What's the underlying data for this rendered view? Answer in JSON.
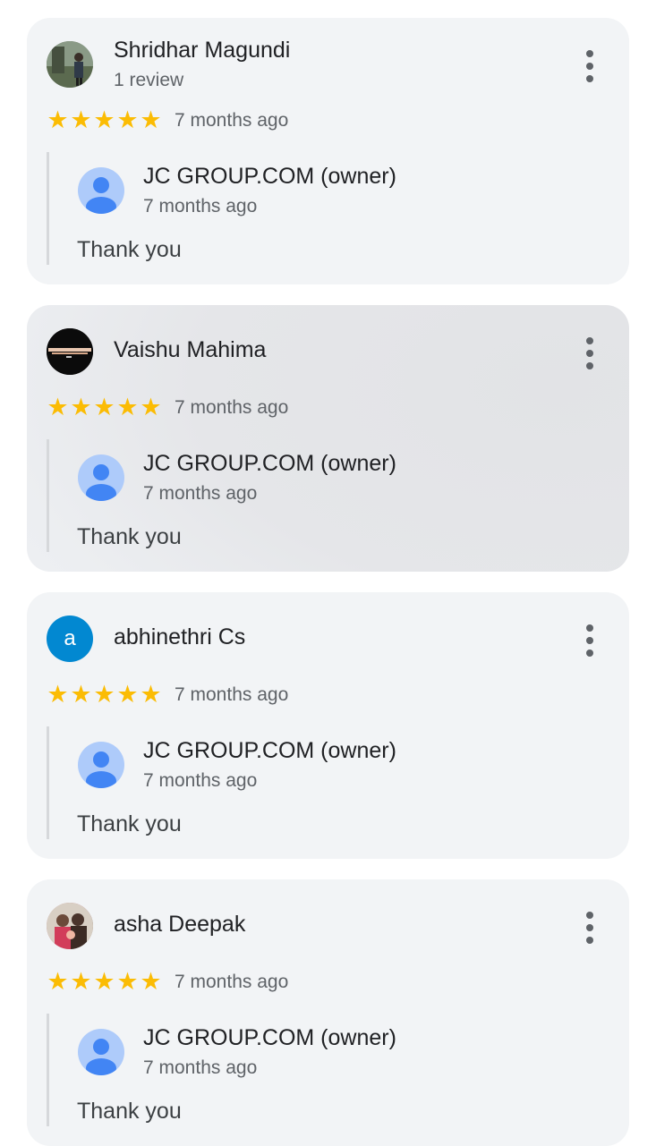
{
  "reviews": [
    {
      "name": "Shridhar Magundi",
      "subtitle": "1 review",
      "avatar": "photo-landscape",
      "stars": 5,
      "time": "7 months ago",
      "reply": {
        "owner": "JC GROUP.COM (owner)",
        "time": "7 months ago",
        "text": "Thank you"
      }
    },
    {
      "name": "Vaishu Mahima",
      "subtitle": "",
      "avatar": "photo-dark",
      "stars": 5,
      "time": "7 months ago",
      "reply": {
        "owner": "JC GROUP.COM (owner)",
        "time": "7 months ago",
        "text": "Thank you"
      }
    },
    {
      "name": "abhinethri Cs",
      "subtitle": "",
      "avatar_letter": "a",
      "stars": 5,
      "time": "7 months ago",
      "reply": {
        "owner": "JC GROUP.COM (owner)",
        "time": "7 months ago",
        "text": "Thank you"
      }
    },
    {
      "name": "asha Deepak",
      "subtitle": "",
      "avatar": "photo-people",
      "stars": 5,
      "time": "7 months ago",
      "reply": {
        "owner": "JC GROUP.COM (owner)",
        "time": "7 months ago",
        "text": "Thank you"
      }
    }
  ],
  "icons": {
    "more": "more-vert-icon",
    "star": "star-icon",
    "owner_avatar": "person-icon"
  },
  "colors": {
    "star": "#fbbc04",
    "card": "#f2f4f6",
    "letter_avatar": "#0288d1",
    "owner_avatar": "#aecbfa"
  }
}
